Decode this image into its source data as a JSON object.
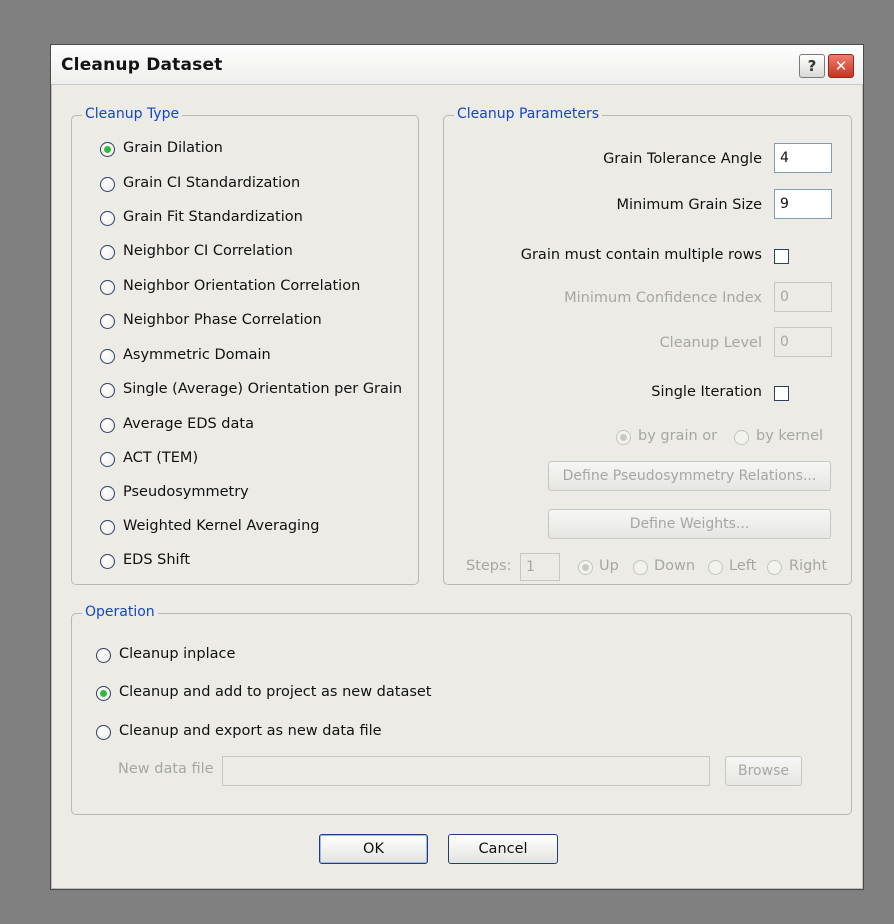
{
  "dialog": {
    "title": "Cleanup Dataset",
    "help_button": "?",
    "close_button": "✕"
  },
  "cleanup_type": {
    "legend": "Cleanup Type",
    "options": [
      {
        "label": "Grain Dilation",
        "selected": true
      },
      {
        "label": "Grain CI Standardization",
        "selected": false
      },
      {
        "label": "Grain Fit Standardization",
        "selected": false
      },
      {
        "label": "Neighbor CI Correlation",
        "selected": false
      },
      {
        "label": "Neighbor Orientation Correlation",
        "selected": false
      },
      {
        "label": "Neighbor Phase Correlation",
        "selected": false
      },
      {
        "label": "Asymmetric Domain",
        "selected": false
      },
      {
        "label": "Single (Average) Orientation per Grain",
        "selected": false
      },
      {
        "label": "Average EDS data",
        "selected": false
      },
      {
        "label": "ACT (TEM)",
        "selected": false
      },
      {
        "label": "Pseudosymmetry",
        "selected": false
      },
      {
        "label": "Weighted Kernel Averaging",
        "selected": false
      },
      {
        "label": "EDS Shift",
        "selected": false
      }
    ]
  },
  "cleanup_parameters": {
    "legend": "Cleanup Parameters",
    "grain_tolerance_angle": {
      "label": "Grain Tolerance Angle",
      "value": "4"
    },
    "minimum_grain_size": {
      "label": "Minimum Grain Size",
      "value": "9"
    },
    "multiple_rows": {
      "label": "Grain must contain multiple rows",
      "checked": false
    },
    "minimum_confidence_index": {
      "label": "Minimum Confidence Index",
      "value": "0"
    },
    "cleanup_level": {
      "label": "Cleanup Level",
      "value": "0"
    },
    "single_iteration": {
      "label": "Single Iteration",
      "checked": false
    },
    "by_grain": {
      "label": "by grain or",
      "selected": true
    },
    "by_kernel": {
      "label": "by kernel",
      "selected": false
    },
    "define_pseudosymmetry": "Define Pseudosymmetry Relations...",
    "define_weights": "Define Weights...",
    "steps": {
      "label": "Steps:",
      "value": "1"
    },
    "directions": [
      {
        "label": "Up",
        "selected": true
      },
      {
        "label": "Down",
        "selected": false
      },
      {
        "label": "Left",
        "selected": false
      },
      {
        "label": "Right",
        "selected": false
      }
    ]
  },
  "operation": {
    "legend": "Operation",
    "options": [
      {
        "label": "Cleanup inplace",
        "selected": false
      },
      {
        "label": "Cleanup and add to project as new dataset",
        "selected": true
      },
      {
        "label": "Cleanup and export as new data file",
        "selected": false
      }
    ],
    "new_data_file": {
      "label": "New data file",
      "value": ""
    },
    "browse": "Browse"
  },
  "buttons": {
    "ok": "OK",
    "cancel": "Cancel"
  }
}
